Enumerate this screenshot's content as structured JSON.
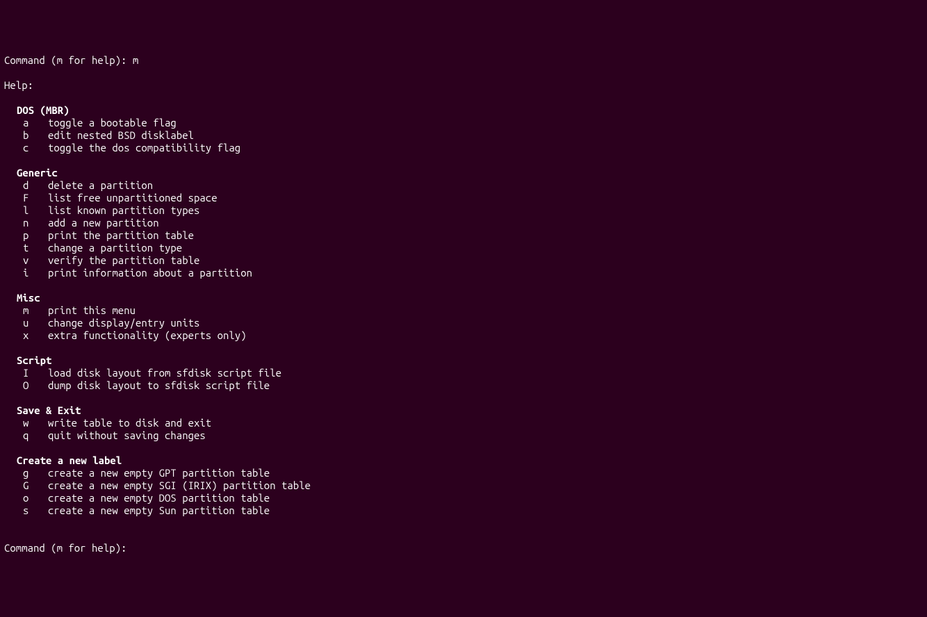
{
  "prompt1": {
    "label": "Command (m for help): ",
    "input": "m"
  },
  "help_label": "Help:",
  "sections": [
    {
      "title": "DOS (MBR)",
      "items": [
        {
          "key": "a",
          "desc": "toggle a bootable flag"
        },
        {
          "key": "b",
          "desc": "edit nested BSD disklabel"
        },
        {
          "key": "c",
          "desc": "toggle the dos compatibility flag"
        }
      ]
    },
    {
      "title": "Generic",
      "items": [
        {
          "key": "d",
          "desc": "delete a partition"
        },
        {
          "key": "F",
          "desc": "list free unpartitioned space"
        },
        {
          "key": "l",
          "desc": "list known partition types"
        },
        {
          "key": "n",
          "desc": "add a new partition"
        },
        {
          "key": "p",
          "desc": "print the partition table"
        },
        {
          "key": "t",
          "desc": "change a partition type"
        },
        {
          "key": "v",
          "desc": "verify the partition table"
        },
        {
          "key": "i",
          "desc": "print information about a partition"
        }
      ]
    },
    {
      "title": "Misc",
      "items": [
        {
          "key": "m",
          "desc": "print this menu"
        },
        {
          "key": "u",
          "desc": "change display/entry units"
        },
        {
          "key": "x",
          "desc": "extra functionality (experts only)"
        }
      ]
    },
    {
      "title": "Script",
      "items": [
        {
          "key": "I",
          "desc": "load disk layout from sfdisk script file"
        },
        {
          "key": "O",
          "desc": "dump disk layout to sfdisk script file"
        }
      ]
    },
    {
      "title": "Save & Exit",
      "items": [
        {
          "key": "w",
          "desc": "write table to disk and exit"
        },
        {
          "key": "q",
          "desc": "quit without saving changes"
        }
      ]
    },
    {
      "title": "Create a new label",
      "items": [
        {
          "key": "g",
          "desc": "create a new empty GPT partition table"
        },
        {
          "key": "G",
          "desc": "create a new empty SGI (IRIX) partition table"
        },
        {
          "key": "o",
          "desc": "create a new empty DOS partition table"
        },
        {
          "key": "s",
          "desc": "create a new empty Sun partition table"
        }
      ]
    }
  ],
  "prompt2": {
    "label": "Command (m for help): "
  }
}
